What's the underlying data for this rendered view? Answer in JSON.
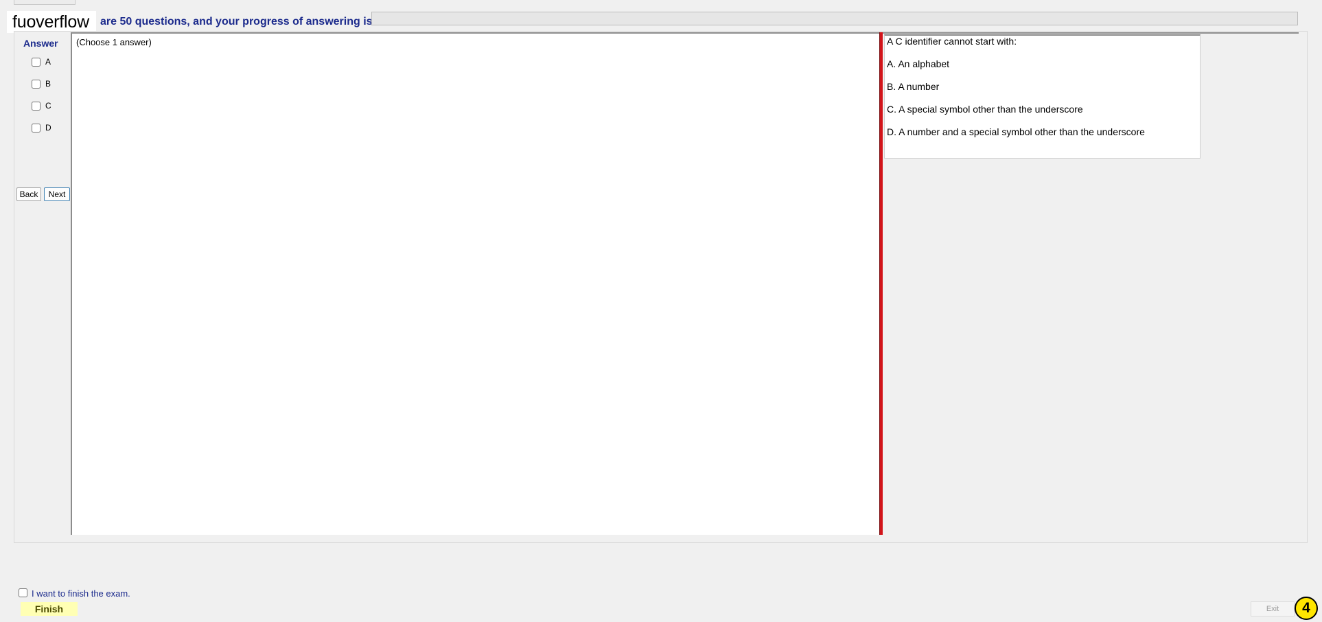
{
  "header": {
    "brand": "fuoverflow",
    "progress_text": "are 50 questions, and your progress of answering is",
    "progress_fraction": 0
  },
  "answer_panel": {
    "heading": "Answer",
    "options": [
      "A",
      "B",
      "C",
      "D"
    ],
    "back_label": "Back",
    "next_label": "Next"
  },
  "question": {
    "instruction": "(Choose 1 answer)",
    "stem": "A C identifier cannot start with:",
    "choices": [
      "A.  An alphabet",
      "B.  A number",
      "C.  A special symbol other than the underscore",
      "D.  A number and a special symbol other than the underscore"
    ]
  },
  "footer": {
    "finish_check_label": "I want to finish the exam.",
    "finish_label": "Finish",
    "exit_label": "Exit",
    "step_badge": "4"
  },
  "colors": {
    "accent_text": "#1b2a8c",
    "splitter": "#d2141a",
    "finish_bg": "#ffffb4",
    "badge": "#ffe600"
  }
}
